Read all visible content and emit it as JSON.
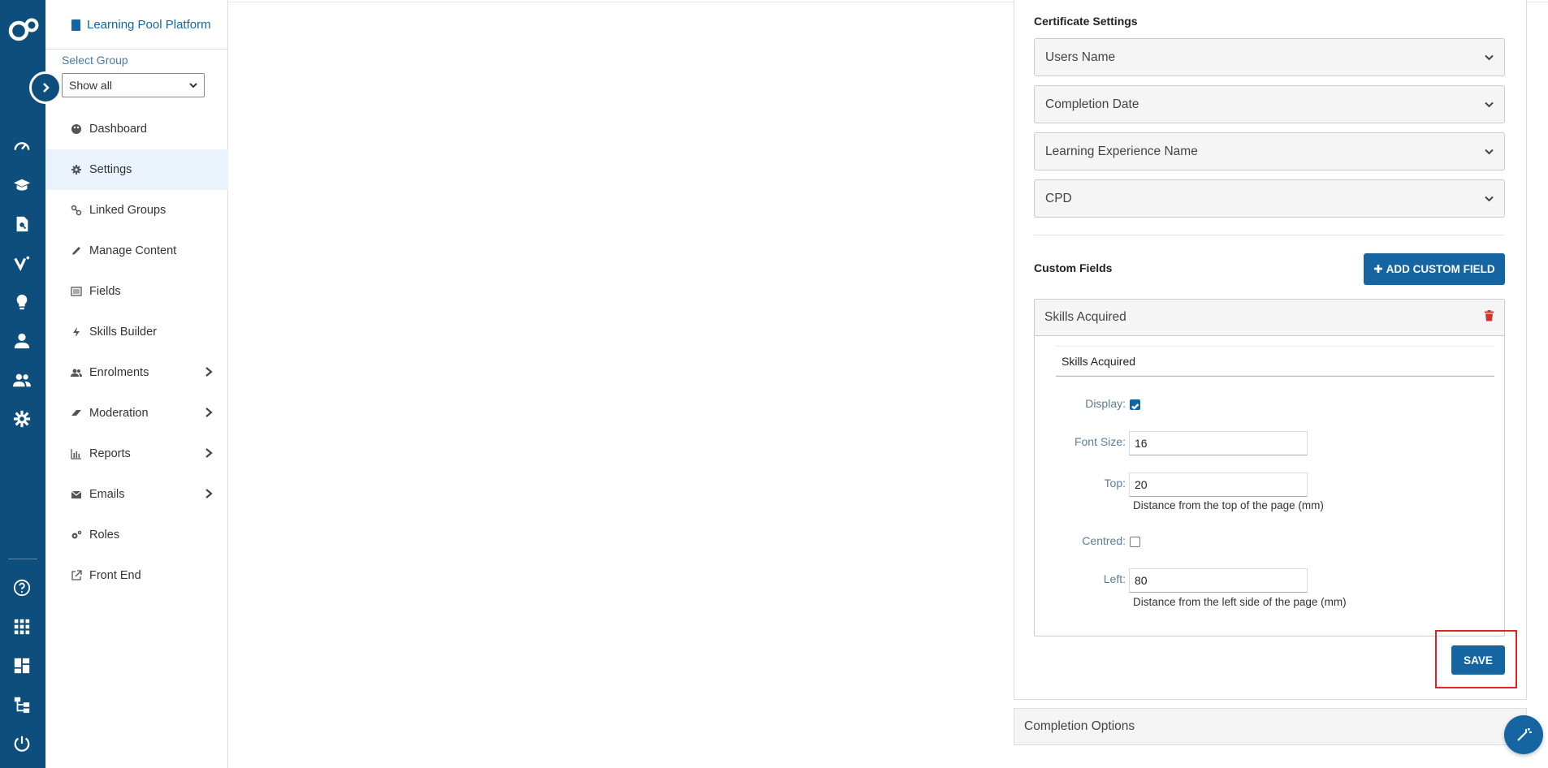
{
  "colors": {
    "rail": "#0e4e7d",
    "primary": "#1565a3",
    "highlight": "#e02424",
    "active_bg": "#eaf3fb"
  },
  "rail": {
    "icons": [
      "dashboard-gauge-icon",
      "graduation-cap-icon",
      "document-search-icon",
      "v-logo-icon",
      "lightbulb-icon",
      "person-icon",
      "people-icon",
      "gear-icon",
      "help-icon",
      "grid-icon",
      "layout-icon",
      "hierarchy-icon",
      "power-icon"
    ]
  },
  "sidebar": {
    "platform_name": "Learning Pool Platform",
    "select_label": "Select Group",
    "select_value": "Show all",
    "items": [
      {
        "label": "Dashboard",
        "icon": "palette-icon",
        "has_children": false
      },
      {
        "label": "Settings",
        "icon": "gear-icon",
        "has_children": false,
        "active": true
      },
      {
        "label": "Linked Groups",
        "icon": "link-icon",
        "has_children": false
      },
      {
        "label": "Manage Content",
        "icon": "pencil-icon",
        "has_children": false
      },
      {
        "label": "Fields",
        "icon": "list-icon",
        "has_children": false
      },
      {
        "label": "Skills Builder",
        "icon": "bolt-icon",
        "has_children": false
      },
      {
        "label": "Enrolments",
        "icon": "users-icon",
        "has_children": true
      },
      {
        "label": "Moderation",
        "icon": "eraser-icon",
        "has_children": true
      },
      {
        "label": "Reports",
        "icon": "bar-chart-icon",
        "has_children": true
      },
      {
        "label": "Emails",
        "icon": "envelope-icon",
        "has_children": true
      },
      {
        "label": "Roles",
        "icon": "cogs-icon",
        "has_children": false
      },
      {
        "label": "Front End",
        "icon": "external-link-icon",
        "has_children": false
      }
    ]
  },
  "certificate": {
    "title": "Certificate Settings",
    "dropdowns": [
      "Users Name",
      "Completion Date",
      "Learning Experience Name",
      "CPD"
    ]
  },
  "custom_fields": {
    "title": "Custom Fields",
    "add_button": "ADD CUSTOM FIELD",
    "field": {
      "header": "Skills Acquired",
      "name_value": "Skills Acquired",
      "display_label": "Display:",
      "display_checked": true,
      "font_size_label": "Font Size:",
      "font_size_value": "16",
      "top_label": "Top:",
      "top_value": "20",
      "top_help": "Distance from the top of the page (mm)",
      "centred_label": "Centred:",
      "centred_checked": false,
      "left_label": "Left:",
      "left_value": "80",
      "left_help": "Distance from the left side of the page (mm)"
    },
    "save_button": "SAVE"
  },
  "completion_options": {
    "label": "Completion Options"
  }
}
